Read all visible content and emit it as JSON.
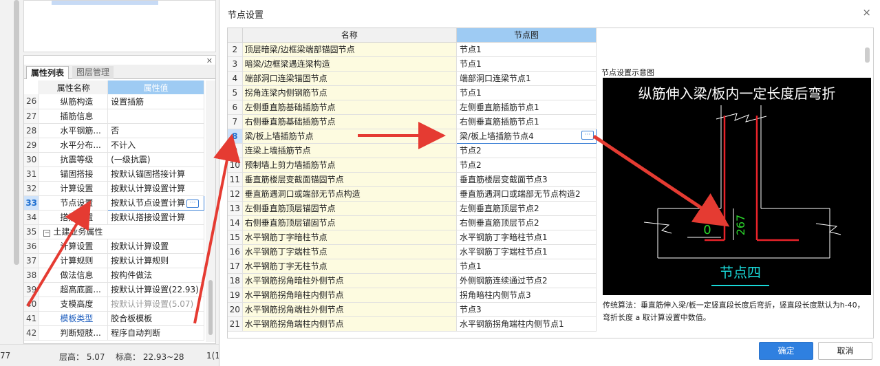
{
  "left_panel": {
    "tabs": [
      "属性列表",
      "图层管理"
    ],
    "header": {
      "name": "属性名称",
      "value": "属性值"
    },
    "rows": [
      {
        "n": "26",
        "name": "纵筋构造",
        "value": "设置插筋"
      },
      {
        "n": "27",
        "name": "插筋信息",
        "value": ""
      },
      {
        "n": "28",
        "name": "水平钢筋...",
        "value": "否"
      },
      {
        "n": "29",
        "name": "水平分布...",
        "value": "不计入"
      },
      {
        "n": "30",
        "name": "抗震等级",
        "value": "(一级抗震)"
      },
      {
        "n": "31",
        "name": "锚固搭接",
        "value": "按默认锚固搭接计算"
      },
      {
        "n": "32",
        "name": "计算设置",
        "value": "按默认计算设置计算"
      },
      {
        "n": "33",
        "name": "节点设置",
        "value": "按默认节点设置计算"
      },
      {
        "n": "34",
        "name": "搭接设置",
        "value": "按默认搭接设置计算"
      },
      {
        "n": "35",
        "name": "土建业务属性",
        "value": ""
      },
      {
        "n": "36",
        "name": "计算设置",
        "value": "按默认计算设置"
      },
      {
        "n": "37",
        "name": "计算规则",
        "value": "按默认计算规则"
      },
      {
        "n": "38",
        "name": "做法信息",
        "value": "按构件做法"
      },
      {
        "n": "39",
        "name": "超高底面...",
        "value": "按默认计算设置(22.93)"
      },
      {
        "n": "40",
        "name": "支模高度",
        "value": "按默认计算设置(5.07)"
      },
      {
        "n": "41",
        "name": "模板类型",
        "value": "胶合板模板"
      },
      {
        "n": "42",
        "name": "判断短肢...",
        "value": "程序自动判断"
      }
    ],
    "status": {
      "left": "77",
      "floor_height": "层高：  5.07",
      "elevation": "标高：  22.93~28",
      "right": "1(1"
    }
  },
  "dialog": {
    "title": "节点设置",
    "columns": {
      "name": "名称",
      "node": "节点图"
    },
    "rows": [
      {
        "n": "2",
        "name": "顶层暗梁/边框梁端部锚固节点",
        "node": "节点1"
      },
      {
        "n": "3",
        "name": "暗梁/边框梁遇连梁构造",
        "node": "节点1"
      },
      {
        "n": "4",
        "name": "端部洞口连梁锚固节点",
        "node": "端部洞口连梁节点1"
      },
      {
        "n": "5",
        "name": "拐角连梁内侧钢筋节点",
        "node": "节点1"
      },
      {
        "n": "6",
        "name": "左侧垂直筋基础插筋节点",
        "node": "左侧垂直筋插筋节点1"
      },
      {
        "n": "7",
        "name": "右侧垂直筋基础插筋节点",
        "node": "右侧垂直筋插筋节点1"
      },
      {
        "n": "8",
        "name": "梁/板上墙插筋节点",
        "node": "梁/板上墙插筋节点4"
      },
      {
        "n": "9",
        "name": "连梁上墙插筋节点",
        "node": "节点2"
      },
      {
        "n": "10",
        "name": "预制墙上剪力墙插筋节点",
        "node": "节点2"
      },
      {
        "n": "11",
        "name": "垂直筋楼层变截面锚固节点",
        "node": "垂直筋楼层变截面节点3"
      },
      {
        "n": "12",
        "name": "垂直筋遇洞口或端部无节点构造",
        "node": "垂直筋遇洞口或端部无节点构造2"
      },
      {
        "n": "13",
        "name": "左侧垂直筋顶层锚固节点",
        "node": "左侧垂直筋顶层节点2"
      },
      {
        "n": "14",
        "name": "右侧垂直筋顶层锚固节点",
        "node": "右侧垂直筋顶层节点2"
      },
      {
        "n": "15",
        "name": "水平钢筋丁字暗柱节点",
        "node": "水平钢筋丁字暗柱节点1"
      },
      {
        "n": "16",
        "name": "水平钢筋丁字端柱节点",
        "node": "水平钢筋丁字端柱节点1"
      },
      {
        "n": "17",
        "name": "水平钢筋丁字无柱节点",
        "node": "节点1"
      },
      {
        "n": "18",
        "name": "水平钢筋拐角暗柱外侧节点",
        "node": "外侧钢筋连续通过节点2"
      },
      {
        "n": "19",
        "name": "水平钢筋拐角暗柱内侧节点",
        "node": "拐角暗柱内侧节点3"
      },
      {
        "n": "20",
        "name": "水平钢筋拐角端柱外侧节点",
        "node": "节点3"
      },
      {
        "n": "21",
        "name": "水平钢筋拐角端柱内侧节点",
        "node": "水平钢筋拐角端柱内侧节点1"
      }
    ],
    "preview_label": "节点设置示意图",
    "diagram": {
      "heading": "纵筋伸入梁/板内一定长度后弯折",
      "dim_zero": "0",
      "dim_267": "267",
      "caption": "节点四"
    },
    "description": "传统算法：垂直筋伸入梁/板一定竖直段长度后弯折，竖直段长度默认为h-40，弯折长度 a 取计算设置中数值。",
    "ok": "确定",
    "cancel": "取消",
    "close_icon": "×",
    "dots": "···",
    "colors": {
      "accent": "#2f80e0",
      "header_blue": "#9ecbf3",
      "arrow_red": "#e53b32",
      "diagram_red": "#e8232a",
      "diagram_green": "#2bd62b",
      "diagram_cyan": "#19d8d8"
    }
  }
}
